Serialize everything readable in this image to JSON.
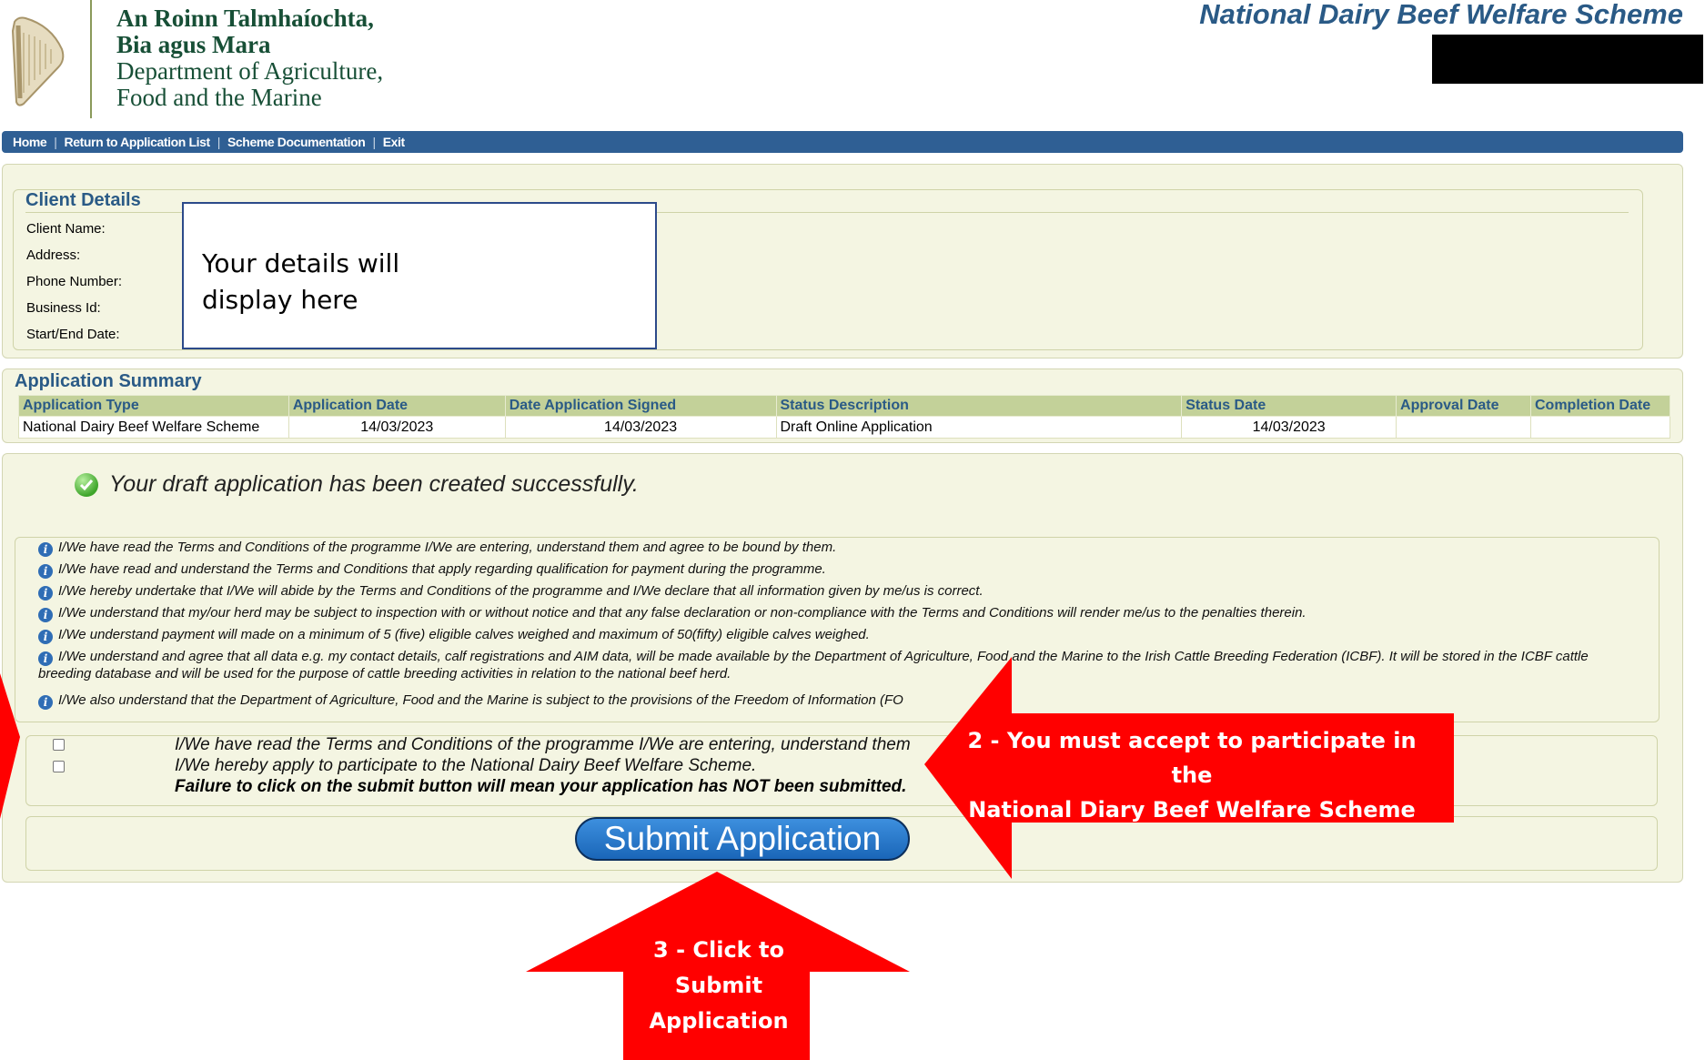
{
  "header": {
    "dept_irish_line1": "An Roinn Talmhaíochta,",
    "dept_irish_line2": "Bia agus Mara",
    "dept_eng_line1": "Department of Agriculture,",
    "dept_eng_line2": "Food and the Marine",
    "scheme_title": "National Dairy Beef Welfare Scheme"
  },
  "nav": {
    "home": "Home",
    "return": "Return to Application List",
    "docs": "Scheme Documentation",
    "exit": "Exit",
    "separator": "|"
  },
  "client": {
    "legend": "Client Details",
    "labels": [
      "Client Name:",
      "Address:",
      "Phone Number:",
      "Business Id:",
      "Start/End Date:"
    ],
    "placeholder_line1": "Your details will",
    "placeholder_line2": "display here"
  },
  "summary": {
    "legend": "Application Summary",
    "headers": [
      "Application Type",
      "Application Date",
      "Date Application Signed",
      "Status Description",
      "Status Date",
      "Approval Date",
      "Completion Date"
    ],
    "row": [
      "National Dairy Beef Welfare Scheme",
      "14/03/2023",
      "14/03/2023",
      "Draft Online Application",
      "14/03/2023",
      "",
      ""
    ]
  },
  "main": {
    "success": "Your draft application has been created successfully.",
    "terms": [
      "I/We have read the Terms and Conditions of the programme I/We are entering, understand them and agree to be bound by them.",
      "I/We have read and understand the Terms and Conditions that apply regarding qualification for payment during the programme.",
      "I/We hereby undertake that I/We will abide by the Terms and Conditions of the programme and I/We declare that all information given by me/us is correct.",
      "I/We understand that my/our herd may be subject to inspection with or without notice and that any false declaration or non-compliance with the Terms and Conditions will render me/us to the penalties therein.",
      "I/We understand payment will made on a minimum of 5 (five) eligible calves weighed and maximum of 50(fifty) eligible calves weighed.",
      "I/We understand and agree that all data e.g. my contact details, calf registrations and AIM data, will be made available by the Department of Agriculture, Food and the Marine to the Irish Cattle Breeding Federation (ICBF). It will be stored in the ICBF cattle breeding database and will be used for the purpose of cattle breeding activities in relation to the national beef herd.",
      "I/We also understand that the Department of Agriculture, Food and the Marine is subject to the provisions of the Freedom of Information (FO"
    ],
    "accept1": "I/We have read the Terms and Conditions of the programme I/We are entering, understand them",
    "accept2": "I/We hereby apply to participate to the National Dairy Beef Welfare Scheme.",
    "warning": "Failure to click on the submit button will mean your application has NOT been submitted.",
    "submit": "Submit Application"
  },
  "annotations": {
    "callout2_line1": "2 - You must accept to participate in the",
    "callout2_line2": "National Diary Beef Welfare Scheme",
    "callout3_line1": "3 - Click to",
    "callout3_line2": "Submit",
    "callout3_line3": "Application",
    "arrow_color": "#ff0000"
  }
}
